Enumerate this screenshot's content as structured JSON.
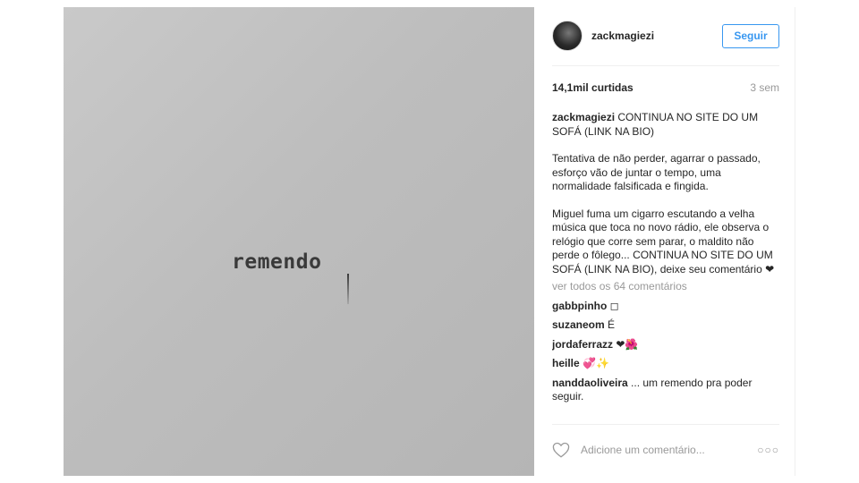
{
  "photo": {
    "text": "remendo"
  },
  "header": {
    "username": "zackmagiezi",
    "follow_label": "Seguir"
  },
  "stats": {
    "likes": "14,1mil curtidas",
    "age": "3 sem"
  },
  "caption": {
    "username": "zackmagiezi",
    "p1": "CONTINUA NO SITE DO UM SOFÁ (LINK NA BIO)",
    "p2": "Tentativa de não perder, agarrar o passado, esforço vão de juntar o tempo, uma normalidade falsificada e fingida.",
    "p3": "Miguel fuma um cigarro escutando a velha música que toca no novo rádio, ele observa o relógio que corre sem parar, o maldito não perde o fôlego... CONTINUA NO SITE DO UM SOFÁ (LINK NA BIO), deixe seu comentário ❤"
  },
  "view_all": "ver todos os 64 comentários",
  "comments": [
    {
      "user": "gabbpinho",
      "text": "◻"
    },
    {
      "user": "suzaneom",
      "text": "É"
    },
    {
      "user": "jordaferrazz",
      "text": "❤🌺"
    },
    {
      "user": "heille",
      "text": "💞✨"
    },
    {
      "user": "nanddaoliveira",
      "text": "... um remendo pra poder seguir."
    }
  ],
  "add_comment": {
    "placeholder": "Adicione um comentário...",
    "more_icon": "more-dots-icon",
    "heart_icon": "heart-outline-icon"
  },
  "colors": {
    "accent": "#3897f0",
    "muted": "#999999",
    "text": "#262626"
  }
}
